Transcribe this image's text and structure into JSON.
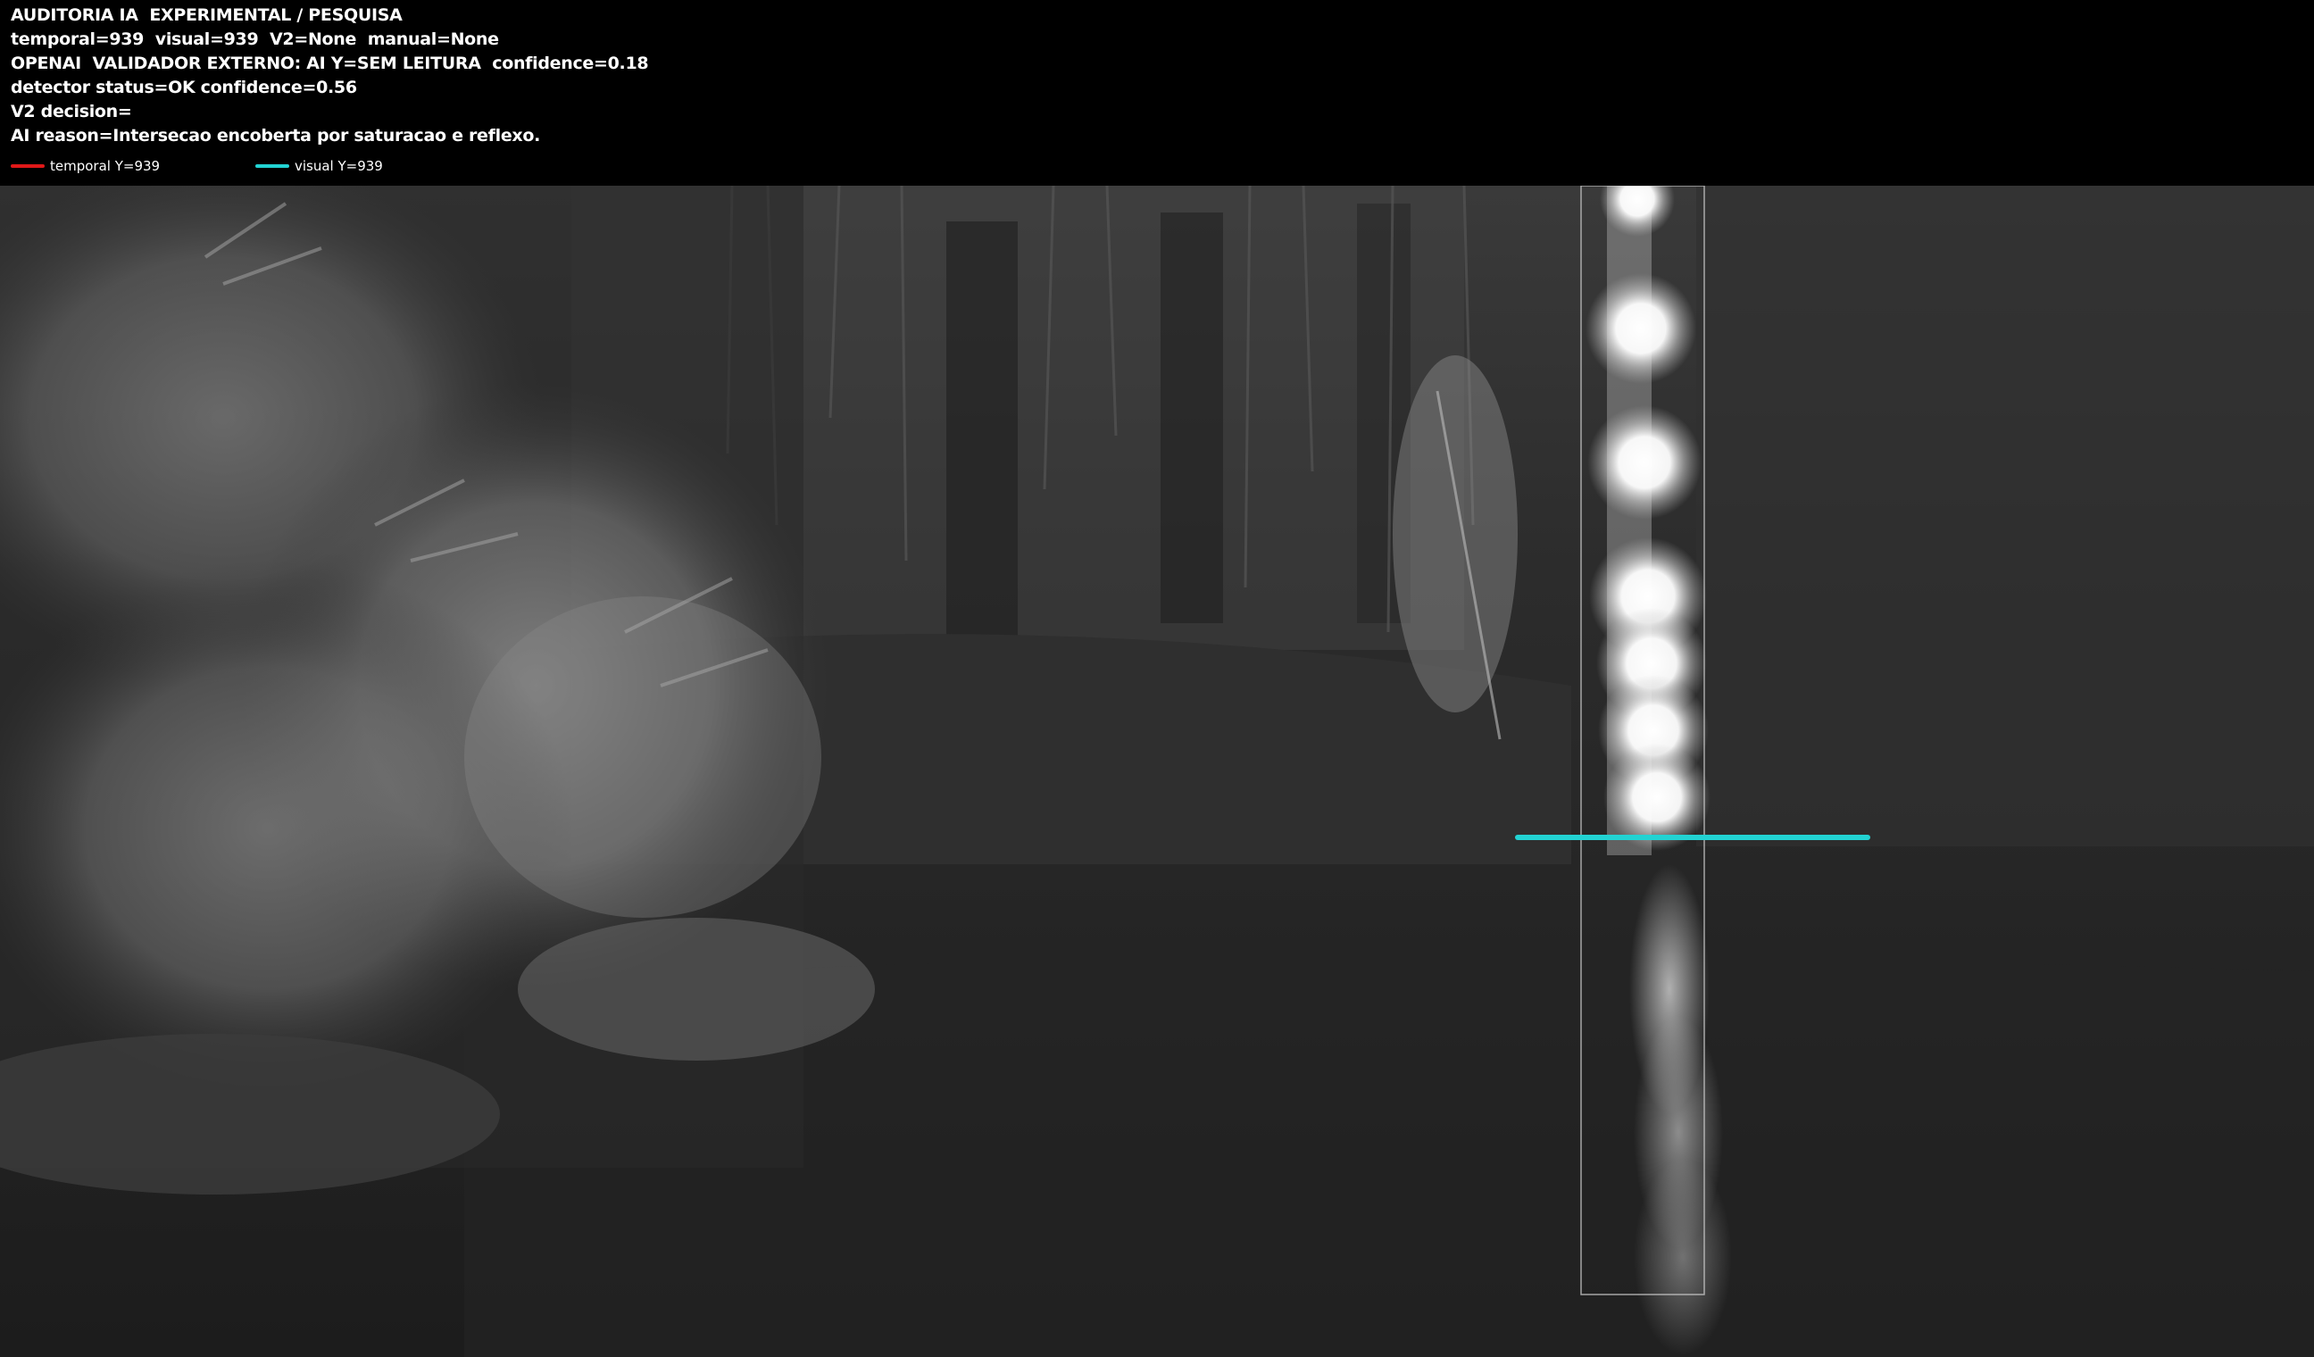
{
  "header": {
    "line1": "AUDITORIA IA  EXPERIMENTAL / PESQUISA",
    "line2": "temporal=939  visual=939  V2=None  manual=None",
    "line3": "OPENAI  VALIDADOR EXTERNO: AI Y=SEM LEITURA  confidence=0.18",
    "line4": "detector status=OK confidence=0.56",
    "line5": "V2 decision=",
    "line6": "AI reason=Intersecao encoberta por saturacao e reflexo."
  },
  "legend": {
    "temporal": {
      "label": "temporal Y=939",
      "color": "#e01818"
    },
    "visual": {
      "label": "visual Y=939",
      "color": "#22d3d3"
    }
  },
  "overlay": {
    "visual_line_color": "#22d3d3",
    "roi_box_color": "#c8c8c8"
  }
}
